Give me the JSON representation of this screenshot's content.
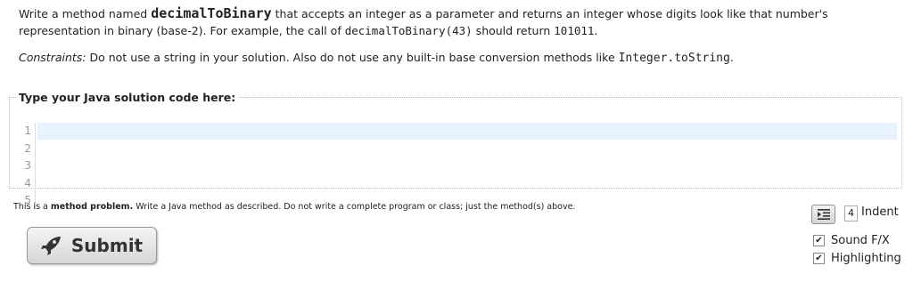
{
  "prompt": {
    "p1_pre": "Write a method named ",
    "method_name": "decimalToBinary",
    "p1_mid": " that accepts an integer as a parameter and returns an integer whose digits look like that number's representation in binary (base-2). For example, the call of ",
    "example_call": "decimalToBinary(43)",
    "p1_mid2": " should return ",
    "example_result": "101011",
    "p1_end": ".",
    "constraints_label": "Constraints:",
    "constraints_text": " Do not use a string in your solution. Also do not use any built-in base conversion methods like ",
    "constraints_code": "Integer.toString",
    "constraints_end": "."
  },
  "editor": {
    "legend": "Type your Java solution code here:",
    "line_numbers": [
      "1",
      "2",
      "3",
      "4",
      "5"
    ]
  },
  "note": {
    "pre": "This is a ",
    "bold": "method problem.",
    "post": " Write a Java method as described. Do not write a complete program or class; just the method(s) above."
  },
  "submit_label": "Submit",
  "indent": {
    "value": "4",
    "label": "Indent"
  },
  "options": [
    {
      "label": "Sound F/X",
      "checked": true
    },
    {
      "label": "Highlighting",
      "checked": true
    }
  ],
  "icons": {
    "submit": "rocket-icon",
    "indent": "indent-icon",
    "checkbox": "checkmark-icon"
  }
}
